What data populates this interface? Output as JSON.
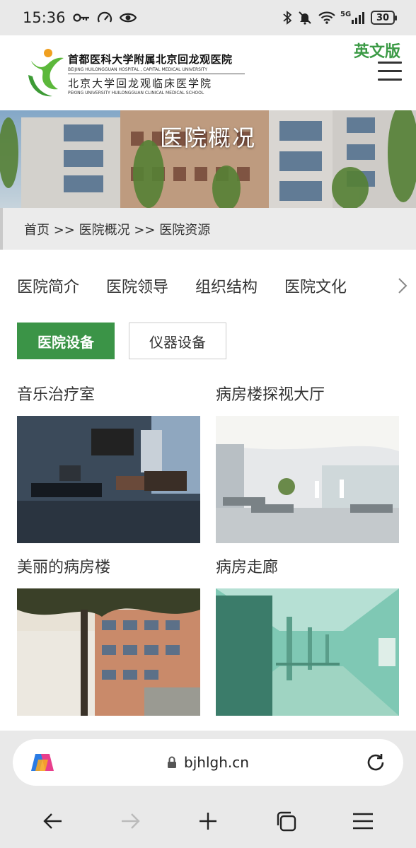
{
  "status_bar": {
    "time": "15:36",
    "icons_left": [
      "key-icon",
      "speedometer-icon",
      "eye-icon"
    ],
    "icons_right": [
      "bluetooth-icon",
      "mute-icon",
      "wifi-icon",
      "signal-5g-icon",
      "battery-icon"
    ],
    "network_label": "5G",
    "battery": "30"
  },
  "header": {
    "logo_cn_line1": "首都医科大学附属北京回龙观医院",
    "logo_en_line1": "BEIJING HUILONGGUAN HOSPITAL , CAPITAL MEDICAL UNIVERSITY",
    "logo_cn_line2": "北京大学回龙观临床医学院",
    "logo_en_line2": "PEKING UNIVERSITY HUILONGGUAN CLINICAL MEDICAL SCHOOL",
    "english_link": "英文版",
    "accent_color": "#3b9a45"
  },
  "banner": {
    "title": "医院概况"
  },
  "breadcrumb": {
    "text": "首页 >> 医院概况 >> 医院资源"
  },
  "tabs": [
    "医院简介",
    "医院领导",
    "组织结构",
    "医院文化"
  ],
  "subtabs": {
    "active": "医院设备",
    "inactive": "仪器设备"
  },
  "items": [
    {
      "title": "音乐治疗室"
    },
    {
      "title": "病房楼探视大厅"
    },
    {
      "title": "美丽的病房楼"
    },
    {
      "title": "病房走廊"
    }
  ],
  "browser": {
    "url": "bjhlgh.cn"
  }
}
